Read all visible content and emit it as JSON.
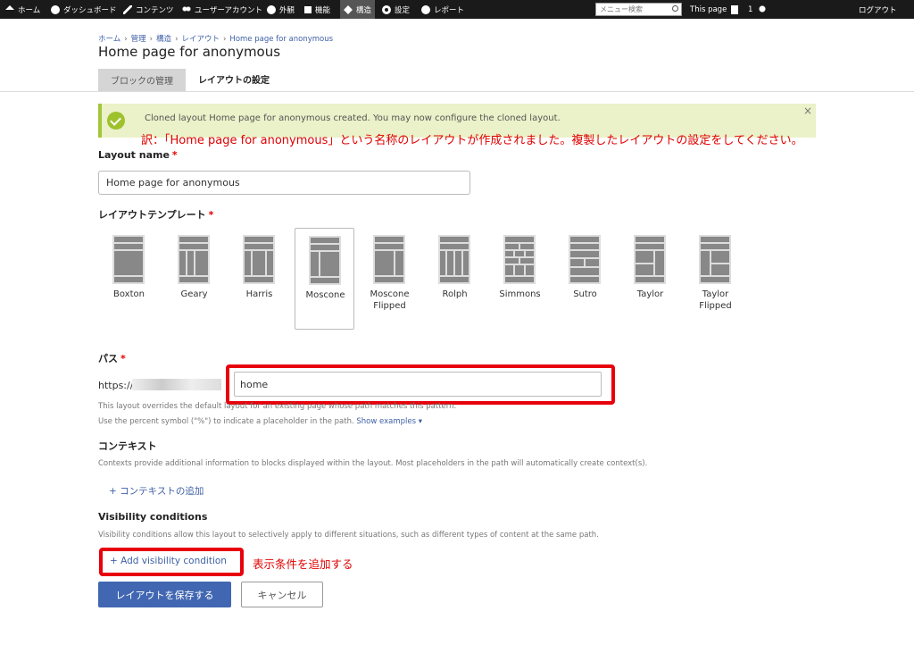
{
  "toolbar": {
    "items": [
      {
        "label": "ホーム",
        "icon": "home-icon"
      },
      {
        "label": "ダッシュボード",
        "icon": "dashboard-icon"
      },
      {
        "label": "コンテンツ",
        "icon": "pencil-icon"
      },
      {
        "label": "ユーザーアカウント",
        "icon": "users-icon"
      },
      {
        "label": "外観",
        "icon": "palette-icon"
      },
      {
        "label": "機能",
        "icon": "puzzle-icon"
      },
      {
        "label": "構造",
        "icon": "layers-icon"
      },
      {
        "label": "設定",
        "icon": "gear-icon"
      },
      {
        "label": "レポート",
        "icon": "info-icon"
      }
    ],
    "search_placeholder": "メニュー検索",
    "this_page": "This page",
    "user_count": "1",
    "logout": "ログアウト"
  },
  "breadcrumb": [
    "ホーム",
    "管理",
    "構造",
    "レイアウト",
    "Home page for anonymous"
  ],
  "page_title": "Home page for anonymous",
  "tabs": [
    {
      "label": "ブロックの管理"
    },
    {
      "label": "レイアウトの設定"
    }
  ],
  "status": {
    "message": "Cloned layout Home page for anonymous created. You may now configure the cloned layout.",
    "close": "×"
  },
  "annotations": {
    "translation": "訳：「Home page for anonymous」という名称のレイアウトが作成されました。複製したレイアウトの設定をしてください。",
    "visibility": "表示条件を追加する"
  },
  "form": {
    "layout_name_label": "Layout name",
    "required_mark": "*",
    "layout_name_value": "Home page for anonymous",
    "template_label": "レイアウトテンプレート",
    "templates": [
      {
        "name": "Boxton"
      },
      {
        "name": "Geary"
      },
      {
        "name": "Harris"
      },
      {
        "name": "Moscone"
      },
      {
        "name": "Moscone Flipped"
      },
      {
        "name": "Rolph"
      },
      {
        "name": "Simmons"
      },
      {
        "name": "Sutro"
      },
      {
        "name": "Taylor"
      },
      {
        "name": "Taylor Flipped"
      }
    ],
    "selected_template": "Moscone",
    "path_label": "パス",
    "path_prefix": "https://",
    "path_value": "home",
    "path_help_1": "This layout overrides the default layout for an existing page whose path matches this pattern.",
    "path_help_2": "Use the percent symbol (\"%\") to indicate a placeholder in the path.",
    "show_examples": "Show examples ▾",
    "context_label": "コンテキスト",
    "context_help": "Contexts provide additional information to blocks displayed within the layout. Most placeholders in the path will automatically create context(s).",
    "add_context": "+ コンテキストの追加",
    "visibility_label": "Visibility conditions",
    "visibility_help": "Visibility conditions allow this layout to selectively apply to different situations, such as different types of content at the same path.",
    "add_visibility": "+ Add visibility condition",
    "save": "レイアウトを保存する",
    "cancel": "キャンセル"
  },
  "colors": {
    "accent": "#4267b2",
    "highlight": "#e8000b",
    "status_bg": "#ebf1c8",
    "status_icon": "#9ec12e"
  }
}
